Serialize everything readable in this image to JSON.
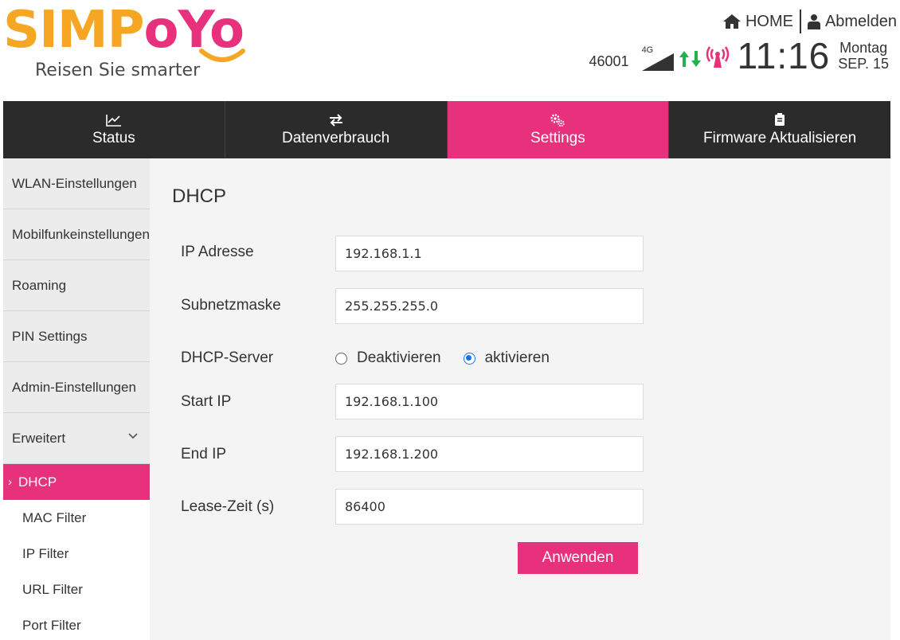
{
  "brand": {
    "logo_text_left": "SIMP",
    "logo_text_right": "oYo",
    "tagline": "Reisen Sie smarter",
    "accent": "#e8317c",
    "logo_orange": "#f5a623"
  },
  "top_links": {
    "home": "HOME",
    "logout": "Abmelden"
  },
  "status": {
    "operator": "46001",
    "network": "4G",
    "time": "11:16",
    "weekday": "Montag",
    "date": "SEP. 15",
    "icons": [
      "signal-icon",
      "data-arrows-icon",
      "wifi-broadcast-icon"
    ]
  },
  "tabs": [
    {
      "label": "Status",
      "icon": "chart-icon",
      "active": false
    },
    {
      "label": "Datenverbrauch",
      "icon": "transfer-icon",
      "active": false
    },
    {
      "label": "Settings",
      "icon": "gears-icon",
      "active": true
    },
    {
      "label": "Firmware Aktualisieren",
      "icon": "firmware-icon",
      "active": false
    }
  ],
  "sidebar": {
    "items": [
      {
        "label": "WLAN-Einstellungen"
      },
      {
        "label": "Mobilfunkeinstellungen"
      },
      {
        "label": "Roaming"
      },
      {
        "label": "PIN Settings"
      },
      {
        "label": "Admin-Einstellungen"
      },
      {
        "label": "Erweitert",
        "expanded": true
      }
    ],
    "subitems": [
      {
        "label": "DHCP",
        "active": true
      },
      {
        "label": "MAC Filter"
      },
      {
        "label": "IP Filter"
      },
      {
        "label": "URL Filter"
      },
      {
        "label": "Port Filter"
      }
    ]
  },
  "main": {
    "title": "DHCP",
    "fields": {
      "ip_label": "IP Adresse",
      "ip_value": "192.168.1.1",
      "subnet_label": "Subnetzmaske",
      "subnet_value": "255.255.255.0",
      "dhcp_label": "DHCP-Server",
      "dhcp_off": "Deaktivieren",
      "dhcp_on": "aktivieren",
      "dhcp_selected": "aktivieren",
      "start_label": "Start IP",
      "start_value": "192.168.1.100",
      "end_label": "End IP",
      "end_value": "192.168.1.200",
      "lease_label": "Lease-Zeit (s)",
      "lease_value": "86400"
    },
    "apply_label": "Anwenden"
  }
}
